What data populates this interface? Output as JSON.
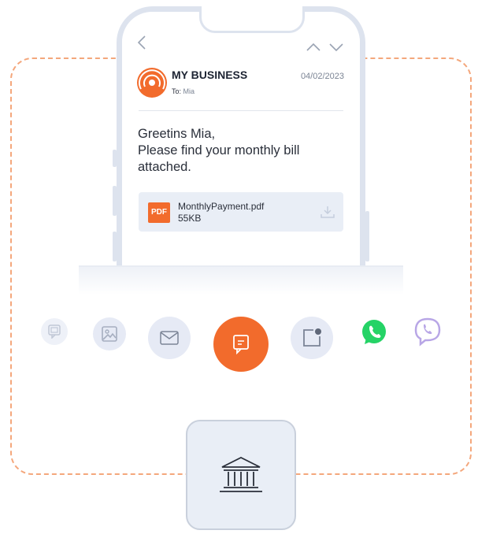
{
  "email": {
    "sender": "MY BUSINESS",
    "date": "04/02/2023",
    "to_label": "To:",
    "to_name": "Mia",
    "body_line1": "Greetins Mia,",
    "body_line2": "Please find your monthly bill",
    "body_line3": "attached.",
    "attachment": {
      "badge": "PDF",
      "name": "MonthlyPayment.pdf",
      "size": "55KB"
    }
  },
  "channels": [
    {
      "icon": "sms-square-icon",
      "active": false
    },
    {
      "icon": "image-icon",
      "active": false
    },
    {
      "icon": "mail-icon",
      "active": false
    },
    {
      "icon": "chat-message-icon",
      "active": true
    },
    {
      "icon": "notification-icon",
      "active": false
    },
    {
      "icon": "whatsapp-icon",
      "active": false
    },
    {
      "icon": "viber-icon",
      "active": false
    }
  ],
  "colors": {
    "accent": "#f26b2c",
    "frame_dash": "#f4a77c",
    "whatsapp": "#25d366",
    "viber": "#7d5cc9"
  },
  "bank_icon": "bank-icon"
}
